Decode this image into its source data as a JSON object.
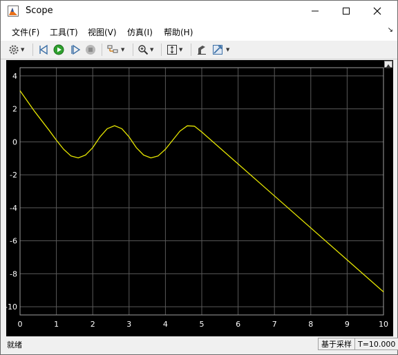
{
  "window": {
    "title": "Scope"
  },
  "menu": [
    {
      "label": "文件(F)"
    },
    {
      "label": "工具(T)"
    },
    {
      "label": "视图(V)"
    },
    {
      "label": "仿真(I)"
    },
    {
      "label": "帮助(H)"
    }
  ],
  "toolbar": {
    "icons": [
      "gear-icon",
      "step-back-icon",
      "run-icon",
      "step-forward-icon",
      "stop-icon",
      "signal-select-icon",
      "zoom-icon",
      "autoscale-icon",
      "highlight-icon",
      "measurement-icon"
    ]
  },
  "colors": {
    "plot_bg": "#000000",
    "grid": "#5a5a5a",
    "trace": "#e6e600",
    "axis_text": "#ffffff",
    "run_green": "#2ea02e"
  },
  "chart_data": {
    "type": "line",
    "title": "",
    "xlabel": "",
    "ylabel": "",
    "xlim": [
      0,
      10
    ],
    "ylim": [
      -10.5,
      4.5
    ],
    "xticks": [
      0,
      1,
      2,
      3,
      4,
      5,
      6,
      7,
      8,
      9,
      10
    ],
    "yticks": [
      4,
      2,
      0,
      -2,
      -4,
      -6,
      -8,
      -10
    ],
    "grid": true,
    "series": [
      {
        "x": [
          0,
          0.4,
          0.8,
          1.0,
          1.2,
          1.4,
          1.6,
          1.8,
          2.0,
          2.2,
          2.4,
          2.6,
          2.8,
          3.0,
          3.2,
          3.4,
          3.6,
          3.8,
          4.0,
          4.2,
          4.4,
          4.6,
          4.8,
          5.0,
          10.0
        ],
        "y": [
          3.1,
          1.85,
          0.7,
          0.1,
          -0.45,
          -0.85,
          -0.97,
          -0.8,
          -0.35,
          0.3,
          0.8,
          0.98,
          0.8,
          0.3,
          -0.35,
          -0.8,
          -0.97,
          -0.85,
          -0.45,
          0.1,
          0.65,
          0.97,
          0.95,
          0.6,
          -9.1
        ]
      }
    ]
  },
  "status": {
    "left": "就绪",
    "mode": "基于采样",
    "time": "T=10.000"
  }
}
